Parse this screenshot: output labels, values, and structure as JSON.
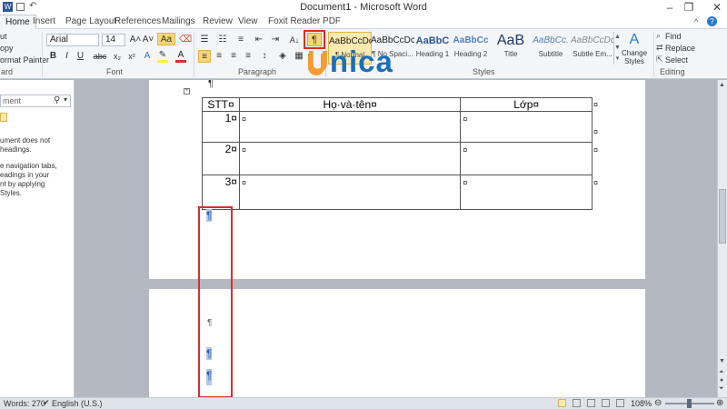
{
  "window": {
    "title": "Document1 - Microsoft Word",
    "minimize": "–",
    "restore": "❐",
    "close": "✕"
  },
  "tabs": [
    {
      "label": "Home"
    },
    {
      "label": "Insert"
    },
    {
      "label": "Page Layout"
    },
    {
      "label": "References"
    },
    {
      "label": "Mailings"
    },
    {
      "label": "Review"
    },
    {
      "label": "View"
    },
    {
      "label": "Foxit Reader PDF"
    }
  ],
  "ribbon": {
    "clipboard": {
      "cut": "ut",
      "copy": "opy",
      "format_painter": "ormat Painter",
      "label": "ard"
    },
    "font": {
      "name": "Arial",
      "size": "14",
      "grow": "A˄",
      "shrink": "A˅",
      "case": "Aa",
      "bold": "B",
      "italic": "I",
      "underline": "U",
      "strike": "abc",
      "sub": "x₂",
      "sup": "x²",
      "label": "Font",
      "text_color": "A"
    },
    "paragraph": {
      "label": "Paragraph",
      "sort": "A↓",
      "show_hide": "¶"
    },
    "styles": {
      "label": "Styles",
      "items": [
        {
          "preview": "AaBbCcDc",
          "name": "¶ Normal"
        },
        {
          "preview": "AaBbCcDc",
          "name": "¶ No Spaci..."
        },
        {
          "preview": "AaBbC",
          "name": "Heading 1"
        },
        {
          "preview": "AaBbCc",
          "name": "Heading 2"
        },
        {
          "preview": "AaB",
          "name": "Title"
        },
        {
          "preview": "AaBbCc.",
          "name": "Subtitle"
        },
        {
          "preview": "AaBbCcDc",
          "name": "Subtle Em..."
        }
      ],
      "change_styles": "Change Styles"
    },
    "editing": {
      "label": "Editing",
      "find": "Find",
      "replace": "Replace",
      "select": "Select"
    }
  },
  "watermark": "Unica",
  "nav_pane": {
    "search_placeholder": "ment",
    "info_lines": [
      "ument does not",
      "headings.",
      "",
      "e navigation tabs,",
      "eadings in your",
      "nt by applying",
      " Styles."
    ]
  },
  "document": {
    "top_mark": "¶",
    "table": {
      "headers": [
        "STT¤",
        "Họ·và·tên¤",
        "Lớp¤"
      ],
      "rows": [
        [
          "1¤",
          "¤",
          "¤"
        ],
        [
          "2¤",
          "¤",
          "¤"
        ],
        [
          "3¤",
          "¤",
          "¤"
        ]
      ],
      "end_mark": "¤"
    },
    "after_table_mark": "¶",
    "page2_marks": [
      "¶",
      "¶",
      "¶"
    ]
  },
  "status": {
    "words": "Words: 270",
    "language": "English (U.S.)",
    "zoom": "108%"
  },
  "colors": {
    "highlight": "#e02a2a",
    "selection": "#b3c8e8",
    "unica_orange": "#f39c34",
    "unica_blue": "#1b6fb8"
  }
}
